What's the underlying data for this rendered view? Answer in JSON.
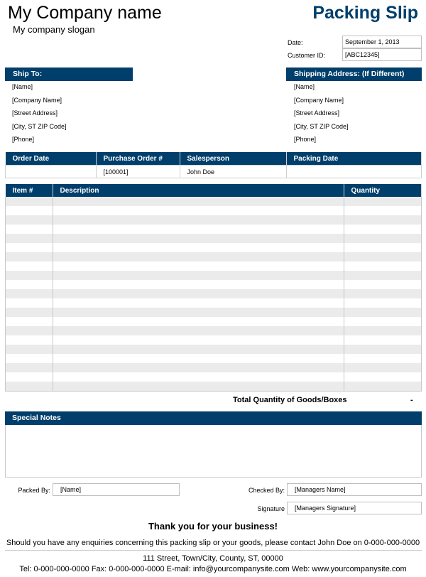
{
  "header": {
    "company_name": "My Company name",
    "slogan": "My company slogan",
    "title": "Packing Slip",
    "brand_color": "#003f6b"
  },
  "meta": {
    "date_label": "Date:",
    "date_value": "September 1, 2013",
    "customer_id_label": "Customer ID:",
    "customer_id_value": "[ABC12345]"
  },
  "ship_to": {
    "title": "Ship To:",
    "lines": [
      "[Name]",
      "[Company Name]",
      "[Street Address]",
      "[City, ST  ZIP Code]",
      "[Phone]"
    ]
  },
  "shipping_address": {
    "title": "Shipping Address: (If Different)",
    "lines": [
      "[Name]",
      "[Company Name]",
      "[Street Address]",
      "[City, ST  ZIP Code]",
      "[Phone]"
    ]
  },
  "order_info": {
    "headers": [
      "Order Date",
      "Purchase Order #",
      "Salesperson",
      "Packing Date"
    ],
    "values": [
      "",
      "[100001]",
      "John Doe",
      ""
    ]
  },
  "items": {
    "headers": [
      "Item #",
      "Description",
      "Quantity"
    ],
    "row_count": 21
  },
  "total": {
    "label": "Total Quantity of Goods/Boxes",
    "value": "-"
  },
  "special_notes": {
    "title": "Special Notes",
    "content": ""
  },
  "signoff": {
    "packed_by_label": "Packed By:",
    "packed_by_value": "[Name]",
    "checked_by_label": "Checked By:",
    "checked_by_value": "[Managers Name]",
    "signature_label": "Signature",
    "signature_value": "[Managers Signature]"
  },
  "footer": {
    "thanks": "Thank you for your business!",
    "enquiry": "Should you have any enquiries concerning this packing slip or your goods, please contact John Doe on 0-000-000-0000",
    "address": "111 Street, Town/City, County, ST, 00000",
    "contact": "Tel: 0-000-000-0000 Fax: 0-000-000-0000 E-mail: info@yourcompanysite.com Web: www.yourcompanysite.com"
  }
}
